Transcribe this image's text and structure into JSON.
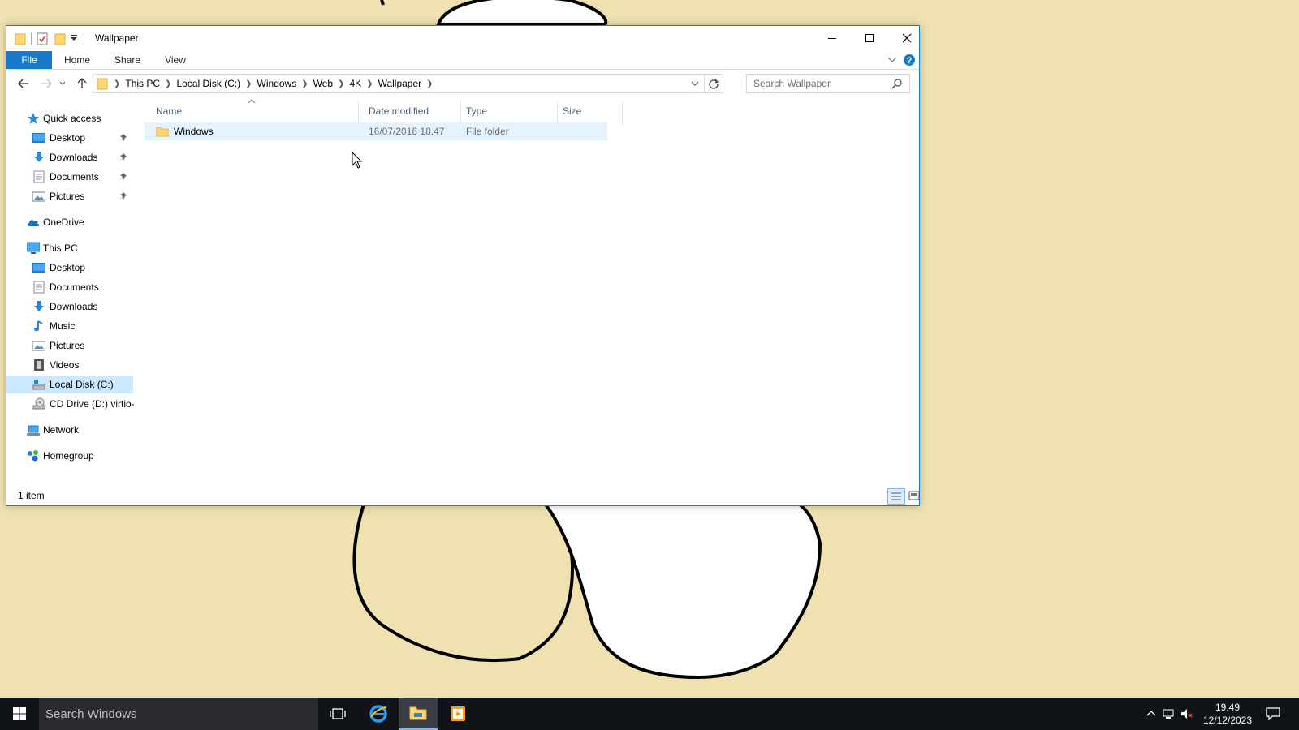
{
  "window": {
    "title": "Wallpaper"
  },
  "ribbon": {
    "tabs": [
      "File",
      "Home",
      "Share",
      "View"
    ]
  },
  "address": {
    "crumbs": [
      "This PC",
      "Local Disk (C:)",
      "Windows",
      "Web",
      "4K",
      "Wallpaper"
    ]
  },
  "search": {
    "placeholder": "Search Wallpaper"
  },
  "nav": {
    "quick_access": "Quick access",
    "quick_items": [
      "Desktop",
      "Downloads",
      "Documents",
      "Pictures"
    ],
    "onedrive": "OneDrive",
    "this_pc": "This PC",
    "pc_items": [
      "Desktop",
      "Documents",
      "Downloads",
      "Music",
      "Pictures",
      "Videos",
      "Local Disk (C:)",
      "CD Drive (D:) virtio-"
    ],
    "network": "Network",
    "homegroup": "Homegroup"
  },
  "columns": {
    "name": "Name",
    "date": "Date modified",
    "type": "Type",
    "size": "Size"
  },
  "files": [
    {
      "name": "Windows",
      "date": "16/07/2016 18.47",
      "type": "File folder",
      "size": ""
    }
  ],
  "status": {
    "count": "1 item"
  },
  "taskbar": {
    "search_text": "Search Windows",
    "time": "19.49",
    "date": "12/12/2023"
  },
  "colors": {
    "accent": "#1979ca",
    "desktop": "#efe2b0",
    "taskbar": "#101317"
  }
}
